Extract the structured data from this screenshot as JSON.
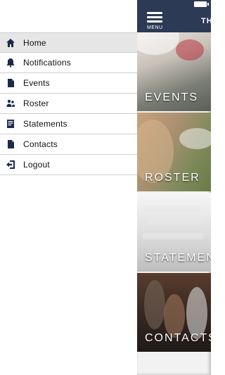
{
  "drawer": {
    "items": [
      {
        "label": "Home",
        "icon": "home-icon",
        "active": true
      },
      {
        "label": "Notifications",
        "icon": "bell-icon",
        "active": false
      },
      {
        "label": "Events",
        "icon": "document-icon",
        "active": false
      },
      {
        "label": "Roster",
        "icon": "people-icon",
        "active": false
      },
      {
        "label": "Statements",
        "icon": "statement-icon",
        "active": false
      },
      {
        "label": "Contacts",
        "icon": "document-icon",
        "active": false
      },
      {
        "label": "Logout",
        "icon": "logout-icon",
        "active": false
      }
    ]
  },
  "app": {
    "menu_label": "MENU",
    "title_fragment": "TH",
    "tiles": [
      {
        "label": "EVENTS"
      },
      {
        "label": "ROSTER"
      },
      {
        "label": "STATEMENTS"
      },
      {
        "label": "CONTACTS"
      }
    ]
  },
  "colors": {
    "topbar": "#2c3a55",
    "active_item_bg": "#e6e6e6",
    "divider": "#cfcfcf"
  }
}
